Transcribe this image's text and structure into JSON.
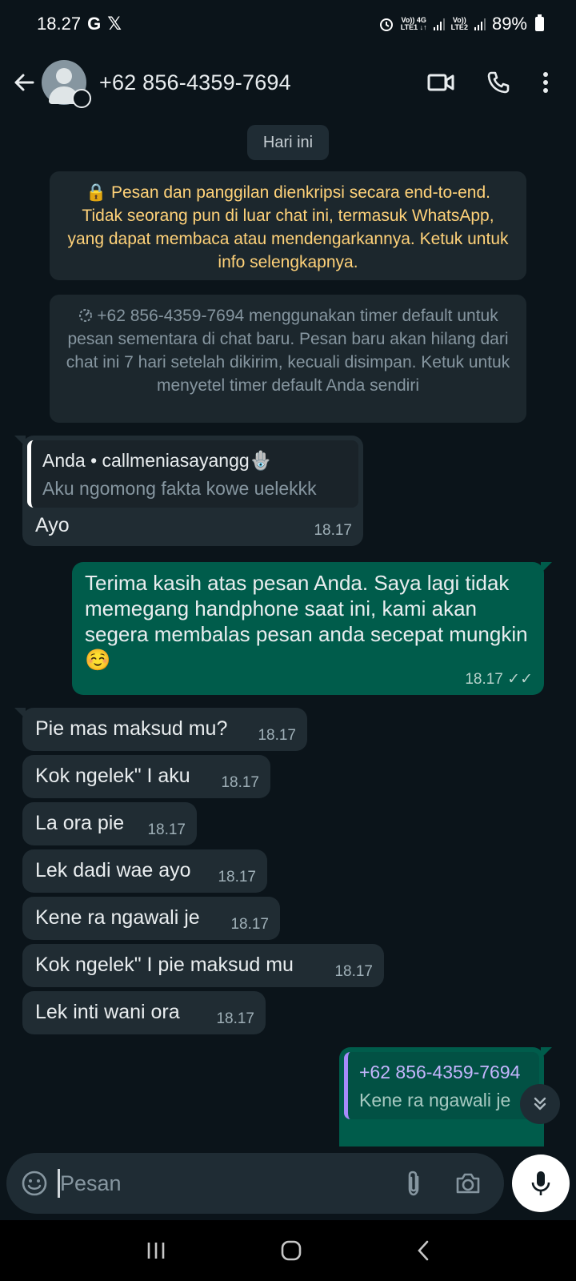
{
  "status_bar": {
    "time": "18.27",
    "carrier_g": "G",
    "carrier_x": "𝕏",
    "sim1_top": "Vo)) 4G",
    "sim1_bottom": "LTE1 ↓↑",
    "sim2_top": "Vo))",
    "sim2_bottom": "LTE2",
    "battery": "89%"
  },
  "header": {
    "contact": "+62 856-4359-7694"
  },
  "chat": {
    "date_label": "Hari ini",
    "encryption_notice": "🔒 Pesan dan panggilan dienkripsi secara end-to-end. Tidak seorang pun di luar chat ini, termasuk WhatsApp, yang dapat membaca atau mendengarkannya. Ketuk untuk info selengkapnya.",
    "timer_notice": "+62 856-4359-7694 menggunakan timer default untuk pesan sementara di chat baru. Pesan baru akan hilang dari chat ini 7 hari setelah dikirim, kecuali disimpan. Ketuk untuk menyetel timer default Anda sendiri",
    "messages": [
      {
        "dir": "in",
        "quote_name": "Anda • callmeniasayangg🪬",
        "quote_text": "Aku ngomong fakta kowe uelekkk",
        "text": "Ayo",
        "time": "18.17"
      },
      {
        "dir": "out",
        "text": "Terima kasih atas pesan Anda. Saya lagi tidak memegang handphone saat ini, kami akan segera membalas pesan anda secepat mungkin☺️",
        "time": "18.17 ✓✓"
      },
      {
        "dir": "in",
        "text": "Pie mas maksud mu?",
        "time": "18.17"
      },
      {
        "dir": "in",
        "text": "Kok ngelek\" I aku",
        "time": "18.17"
      },
      {
        "dir": "in",
        "text": "La ora pie",
        "time": "18.17"
      },
      {
        "dir": "in",
        "text": "Lek dadi wae ayo",
        "time": "18.17"
      },
      {
        "dir": "in",
        "text": "Kene ra ngawali je",
        "time": "18.17"
      },
      {
        "dir": "in",
        "text": "Kok ngelek\" I pie maksud mu",
        "time": "18.17"
      },
      {
        "dir": "in",
        "text": "Lek inti wani ora",
        "time": "18.17"
      },
      {
        "dir": "out",
        "quote_name": "+62 856-4359-7694",
        "quote_text": "Kene ra ngawali je",
        "text": "",
        "time": ""
      }
    ]
  },
  "input": {
    "placeholder": "Pesan"
  },
  "icons": {
    "back": "arrow-left",
    "video": "video-camera",
    "call": "phone",
    "menu": "more-vertical",
    "emoji": "sticker-smile",
    "attach": "paperclip",
    "camera": "camera",
    "mic": "microphone",
    "scroll": "chevrons-down"
  },
  "colors": {
    "background": "#0b141a",
    "incoming_bubble": "#202c33",
    "outgoing_bubble": "#005c4b",
    "system_notice_text": "#ffd279"
  }
}
